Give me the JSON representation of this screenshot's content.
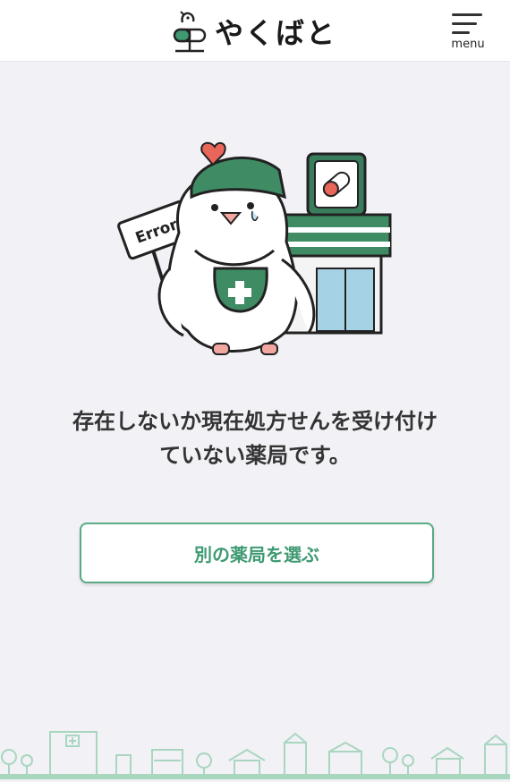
{
  "header": {
    "logo_text": "やくばと",
    "menu_label": "menu"
  },
  "error_badge": "Error",
  "message": {
    "line1": "存在しないか現在処方せんを受け付け",
    "line2": "ていない薬局です。"
  },
  "action": {
    "select_pharmacy_label": "別の薬局を選ぶ"
  },
  "colors": {
    "brand_green": "#3f9a72",
    "dark_green": "#2e7a55",
    "background": "#f1f1f6",
    "town_line": "#a9d6bf"
  }
}
